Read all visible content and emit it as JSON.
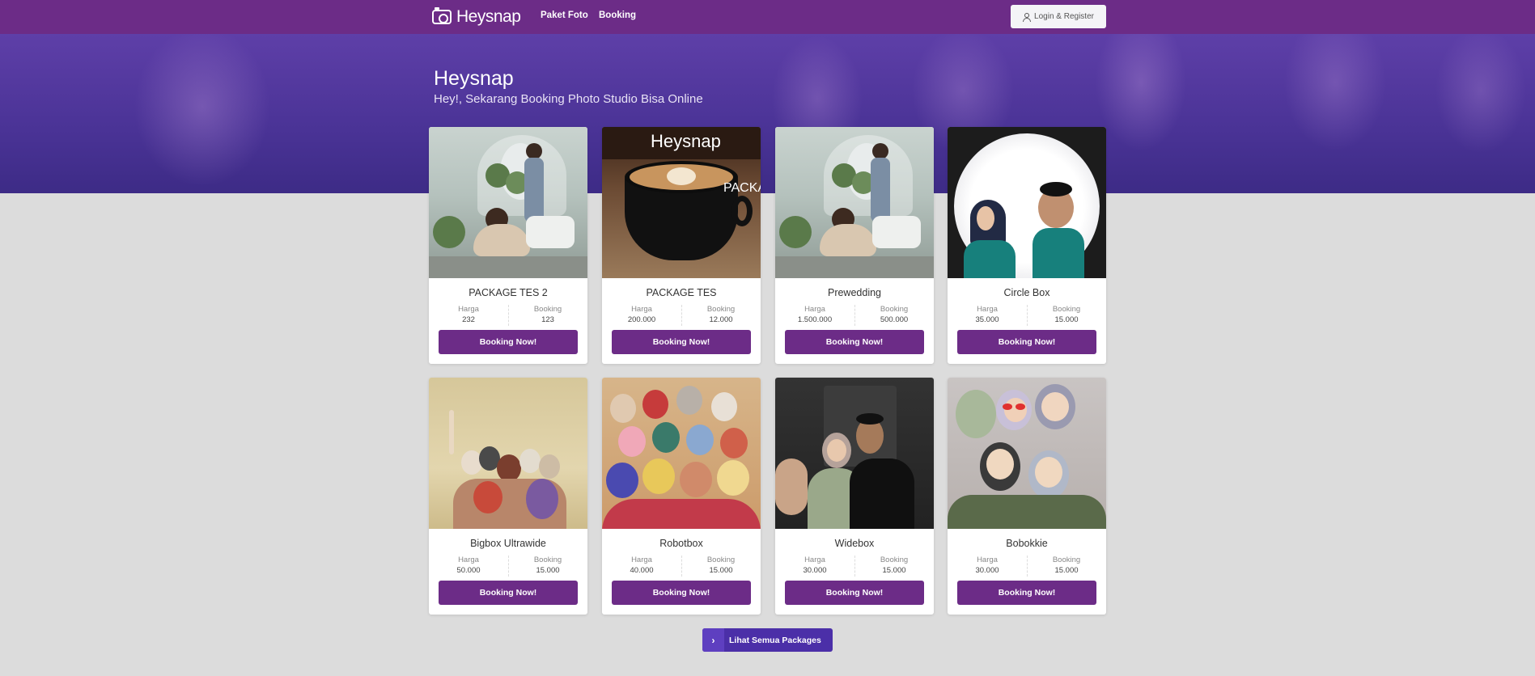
{
  "navbar": {
    "brand": "Heysnap",
    "links": [
      "Paket Foto",
      "Booking"
    ],
    "login_label": "Login & Register"
  },
  "hero": {
    "title": "Heysnap",
    "subtitle": "Hey!, Sekarang Booking Photo Studio Bisa Online"
  },
  "packages": [
    {
      "name": "PACKAGE TES 2",
      "harga_label": "Harga",
      "harga": "232",
      "booking_label": "Booking",
      "booking": "123",
      "button": "Booking Now!",
      "image_overlay": ""
    },
    {
      "name": "PACKAGE TES",
      "harga_label": "Harga",
      "harga": "200.000",
      "booking_label": "Booking",
      "booking": "12.000",
      "button": "Booking Now!",
      "image_overlay": "Heysnap",
      "image_overlay_2": "PACKA"
    },
    {
      "name": "Prewedding",
      "harga_label": "Harga",
      "harga": "1.500.000",
      "booking_label": "Booking",
      "booking": "500.000",
      "button": "Booking Now!",
      "image_overlay": ""
    },
    {
      "name": "Circle Box",
      "harga_label": "Harga",
      "harga": "35.000",
      "booking_label": "Booking",
      "booking": "15.000",
      "button": "Booking Now!",
      "image_overlay": ""
    },
    {
      "name": "Bigbox Ultrawide",
      "harga_label": "Harga",
      "harga": "50.000",
      "booking_label": "Booking",
      "booking": "15.000",
      "button": "Booking Now!",
      "image_overlay": ""
    },
    {
      "name": "Robotbox",
      "harga_label": "Harga",
      "harga": "40.000",
      "booking_label": "Booking",
      "booking": "15.000",
      "button": "Booking Now!",
      "image_overlay": ""
    },
    {
      "name": "Widebox",
      "harga_label": "Harga",
      "harga": "30.000",
      "booking_label": "Booking",
      "booking": "15.000",
      "button": "Booking Now!",
      "image_overlay": ""
    },
    {
      "name": "Bobokkie",
      "harga_label": "Harga",
      "harga": "30.000",
      "booking_label": "Booking",
      "booking": "15.000",
      "button": "Booking Now!",
      "image_overlay": ""
    }
  ],
  "see_all": {
    "label": "Lihat Semua Packages",
    "icon": "chevron-right-icon"
  },
  "colors": {
    "primary": "#6c2c87",
    "hero": "#4a3396",
    "accent": "#4b2fa8",
    "background": "#dcdcdc"
  }
}
